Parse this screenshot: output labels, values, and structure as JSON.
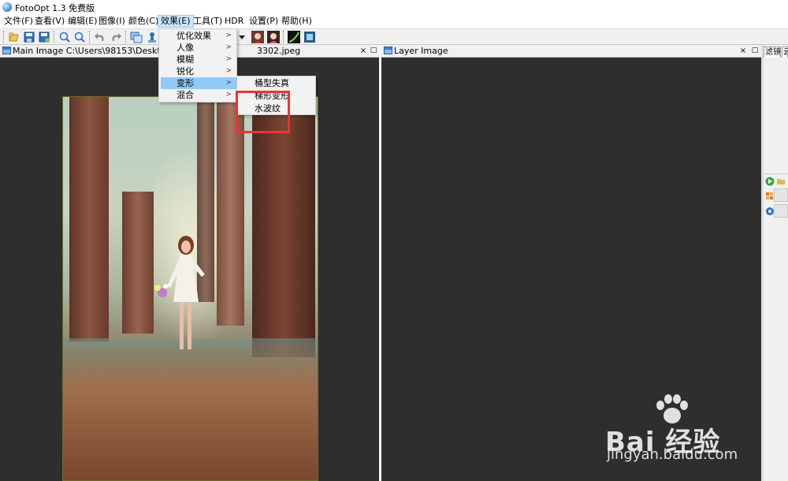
{
  "window": {
    "title": "FotoOpt 1.3 免费版"
  },
  "menubar": {
    "items": [
      {
        "label": "文件(F)"
      },
      {
        "label": "查看(V)"
      },
      {
        "label": "编辑(E)"
      },
      {
        "label": "图像(I)"
      },
      {
        "label": "颜色(C)"
      },
      {
        "label": "效果(E)"
      },
      {
        "label": "工具(T)"
      },
      {
        "label": "HDR"
      },
      {
        "label": "设置(P)"
      },
      {
        "label": "帮助(H)"
      }
    ]
  },
  "effects_menu": {
    "items": [
      {
        "label": "优化效果",
        "arrow": ">"
      },
      {
        "label": "人像",
        "arrow": ">"
      },
      {
        "label": "模糊",
        "arrow": ">"
      },
      {
        "label": "锐化",
        "arrow": ">"
      },
      {
        "label": "变形",
        "arrow": ">"
      },
      {
        "label": "混合",
        "arrow": ">"
      }
    ]
  },
  "deform_submenu": {
    "items": [
      {
        "label": "桶型失真"
      },
      {
        "label": "梯形变形"
      },
      {
        "label": "水波纹"
      }
    ]
  },
  "main_panel": {
    "title": "Main Image C:\\Users\\98153\\Desktop\\",
    "title_tail": "3302.jpeg",
    "close": "×",
    "maximize": "□"
  },
  "layer_panel": {
    "title": "Layer Image",
    "close": "×",
    "maximize": "□"
  },
  "side_panel": {
    "tab1": "滤镜",
    "tab2": "云"
  },
  "watermark": {
    "brand": "Bai 经验",
    "url": "jingyan.baidu.com"
  },
  "colors": {
    "canvas_bg": "#2e2e2e",
    "menu_highlight": "#91c9f7",
    "annotation_red": "#ee3333"
  }
}
